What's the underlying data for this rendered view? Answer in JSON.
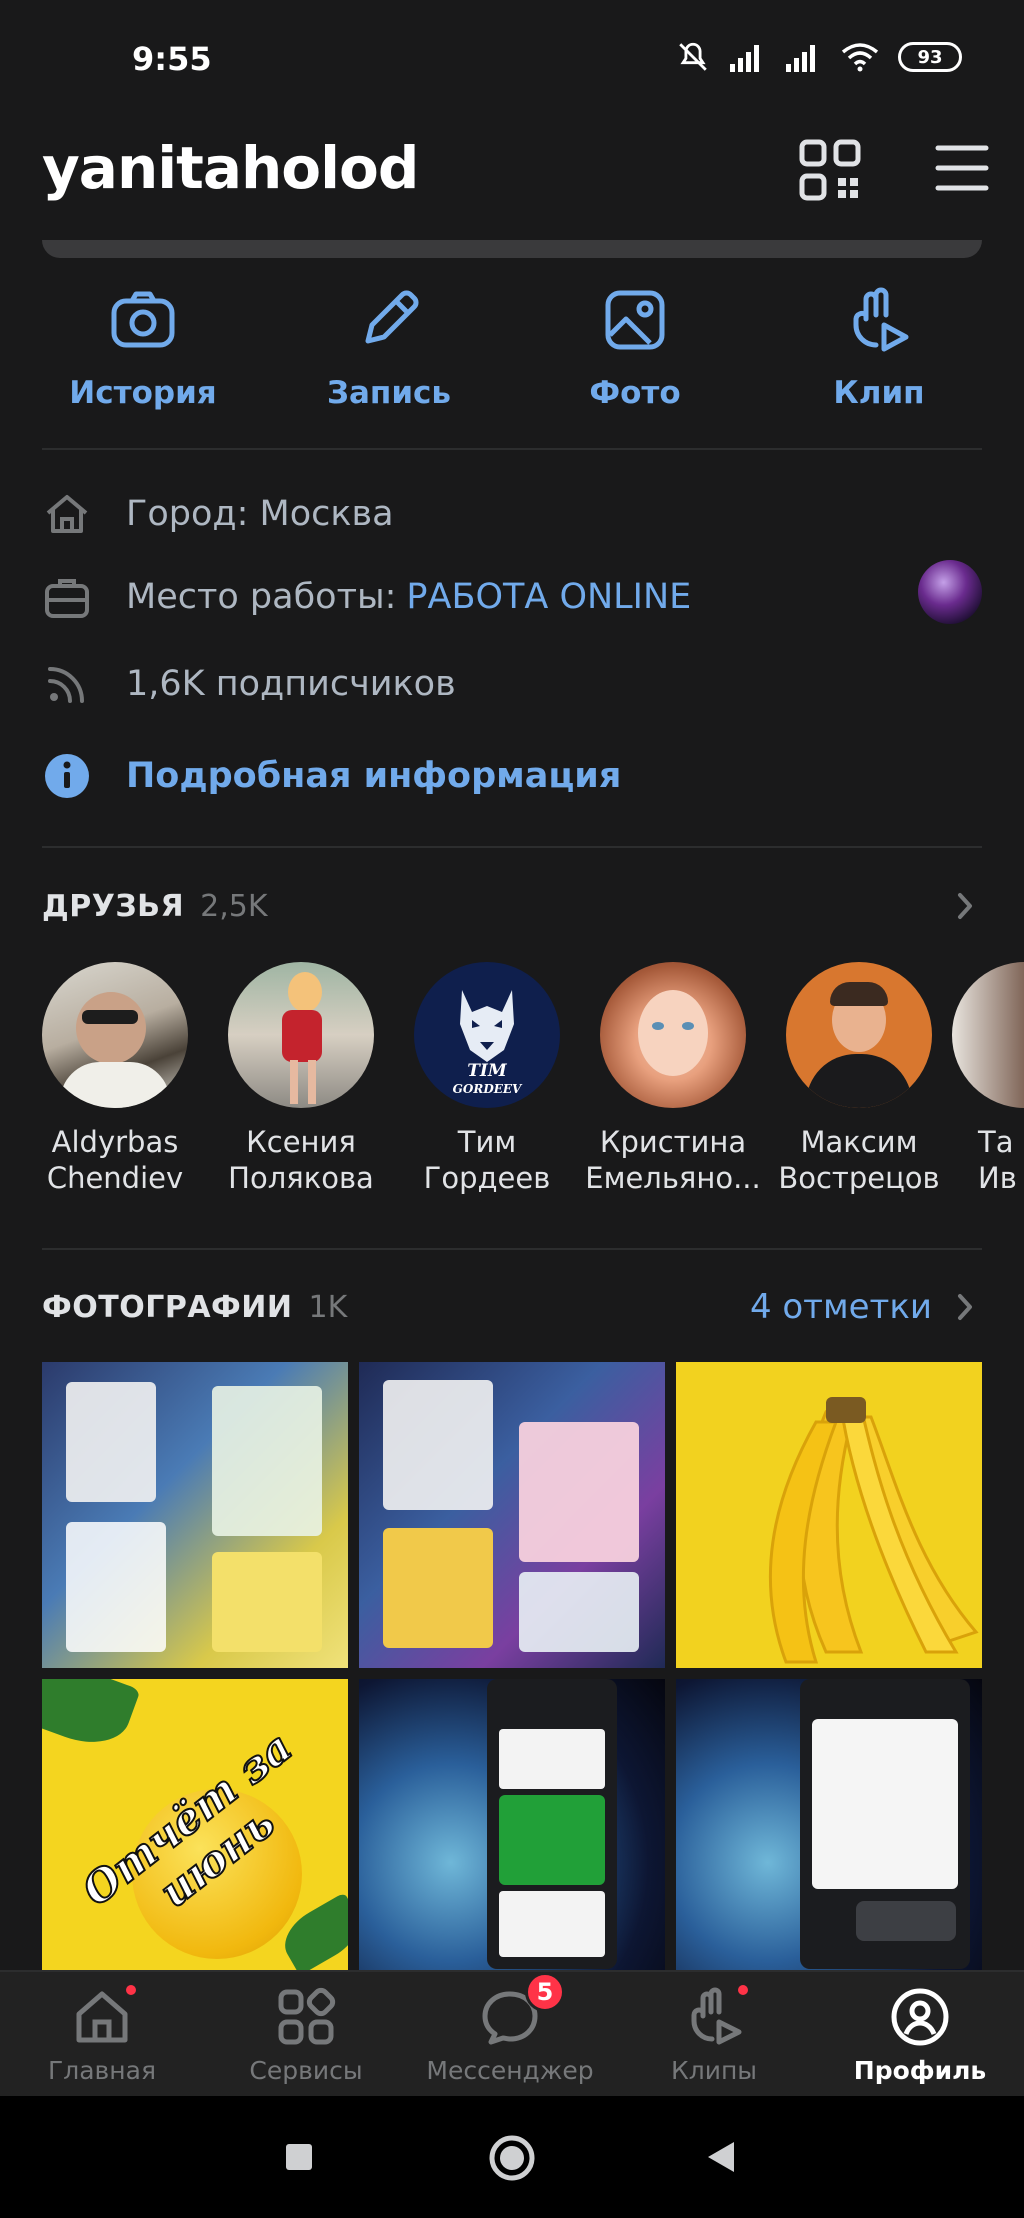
{
  "status_bar": {
    "time": "9:55",
    "battery": "93"
  },
  "header": {
    "username": "yanitaholod"
  },
  "actions": [
    {
      "label": "История",
      "icon": "camera-icon"
    },
    {
      "label": "Запись",
      "icon": "pencil-icon"
    },
    {
      "label": "Фото",
      "icon": "image-icon"
    },
    {
      "label": "Клип",
      "icon": "clip-icon"
    }
  ],
  "info": {
    "city": "Город: Москва",
    "work_prefix": "Место работы: ",
    "work_link": "РАБОТА ONLINE",
    "followers": "1,6K подписчиков",
    "details": "Подробная информация"
  },
  "friends": {
    "title": "ДРУЗЬЯ",
    "count": "2,5K",
    "items": [
      {
        "first": "Aldyrbas",
        "last": "Chendiev"
      },
      {
        "first": "Ксения",
        "last": "Полякова"
      },
      {
        "first": "Тим",
        "last": "Гордеев",
        "avatar_text_1": "TIM",
        "avatar_text_2": "GORDEEV"
      },
      {
        "first": "Кристина",
        "last": "Емельяно..."
      },
      {
        "first": "Максим",
        "last": "Вострецов"
      },
      {
        "first": "Та",
        "last": "Ив"
      }
    ]
  },
  "photos": {
    "title": "ФОТОГРАФИИ",
    "count": "1K",
    "tags_link": "4 отметки",
    "items": [
      {
        "caption": ""
      },
      {
        "caption": ""
      },
      {
        "caption": ""
      },
      {
        "caption": "Отчёт за июнь"
      },
      {
        "caption": ""
      },
      {
        "caption": ""
      }
    ]
  },
  "bottom_nav": [
    {
      "label": "Главная",
      "icon": "home-icon"
    },
    {
      "label": "Сервисы",
      "icon": "services-icon"
    },
    {
      "label": "Мессенджер",
      "icon": "messenger-icon",
      "badge": "5"
    },
    {
      "label": "Клипы",
      "icon": "clips-icon"
    },
    {
      "label": "Профиль",
      "icon": "profile-icon"
    }
  ],
  "colors": {
    "accent": "#71aaeb",
    "background": "#19191a",
    "badge": "#ff3347"
  }
}
